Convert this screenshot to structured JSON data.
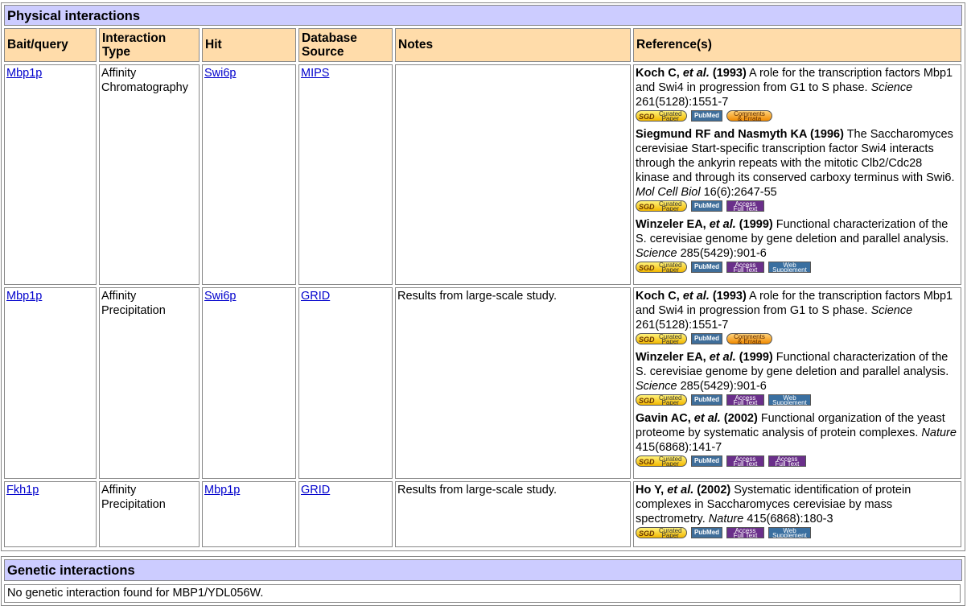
{
  "physical": {
    "title": "Physical interactions",
    "headers": {
      "bait": "Bait/query",
      "itype": "Interaction Type",
      "hit": "Hit",
      "db": "Database Source",
      "notes": "Notes",
      "refs": "Reference(s)"
    },
    "rows": [
      {
        "bait": "Mbp1p",
        "itype": "Affinity Chromatography",
        "hit": "Swi6p",
        "db": "MIPS",
        "notes": "",
        "refs": [
          {
            "authors": "Koch C, ",
            "etal": "et al.",
            "year": " (1993)",
            "text": " A role for the transcription factors Mbp1 and Swi4 in progression from G1 to S phase. ",
            "journal": "Science",
            "cite": " 261(5128):1551-7",
            "badges": [
              "sgd",
              "pubmed",
              "comments"
            ]
          },
          {
            "authors": "Siegmund RF and Nasmyth KA",
            "etal": "",
            "year": " (1996)",
            "text": " The Saccharomyces cerevisiae Start-specific transcription factor Swi4 interacts through the ankyrin repeats with the mitotic Clb2/Cdc28 kinase and through its conserved carboxy terminus with Swi6. ",
            "journal": "Mol Cell Biol",
            "cite": " 16(6):2647-55",
            "badges": [
              "sgd",
              "pubmed",
              "access"
            ]
          },
          {
            "authors": "Winzeler EA, ",
            "etal": "et al.",
            "year": " (1999)",
            "text": " Functional characterization of the S. cerevisiae genome by gene deletion and parallel analysis. ",
            "journal": "Science",
            "cite": " 285(5429):901-6",
            "badges": [
              "sgd",
              "pubmed",
              "access",
              "web"
            ]
          }
        ]
      },
      {
        "bait": "Mbp1p",
        "itype": "Affinity Precipitation",
        "hit": "Swi6p",
        "db": "GRID",
        "notes": "Results from large-scale study.",
        "refs": [
          {
            "authors": "Koch C, ",
            "etal": "et al.",
            "year": " (1993)",
            "text": " A role for the transcription factors Mbp1 and Swi4 in progression from G1 to S phase. ",
            "journal": "Science",
            "cite": " 261(5128):1551-7",
            "badges": [
              "sgd",
              "pubmed",
              "comments"
            ]
          },
          {
            "authors": "Winzeler EA, ",
            "etal": "et al.",
            "year": " (1999)",
            "text": " Functional characterization of the S. cerevisiae genome by gene deletion and parallel analysis. ",
            "journal": "Science",
            "cite": " 285(5429):901-6",
            "badges": [
              "sgd",
              "pubmed",
              "access",
              "web"
            ]
          },
          {
            "authors": "Gavin AC, ",
            "etal": "et al.",
            "year": " (2002)",
            "text": " Functional organization of the yeast proteome by systematic analysis of protein complexes. ",
            "journal": "Nature",
            "cite": " 415(6868):141-7",
            "badges": [
              "sgd",
              "pubmed",
              "access",
              "access"
            ]
          }
        ]
      },
      {
        "bait": "Fkh1p",
        "itype": "Affinity Precipitation",
        "hit": "Mbp1p",
        "db": "GRID",
        "notes": "Results from large-scale study.",
        "refs": [
          {
            "authors": "Ho Y, ",
            "etal": "et al.",
            "year": " (2002)",
            "text": " Systematic identification of protein complexes in Saccharomyces cerevisiae by mass spectrometry. ",
            "journal": "Nature",
            "cite": " 415(6868):180-3",
            "badges": [
              "sgd",
              "pubmed",
              "access",
              "web"
            ]
          }
        ]
      }
    ]
  },
  "badges": {
    "sgd": {
      "logo": "SGD",
      "l1": "Curated",
      "l2": "Paper"
    },
    "pubmed": {
      "l1": "PubMed"
    },
    "comments": {
      "l1": "Comments",
      "l2": "& Errata"
    },
    "access": {
      "l1": "Access",
      "l2": "Full Text"
    },
    "web": {
      "l1": "Web",
      "l2": "Supplement"
    }
  },
  "genetic": {
    "title": "Genetic interactions",
    "message": "No genetic interaction found for MBP1/YDL056W."
  },
  "colors": {
    "section_bg": "#ccccff",
    "header_bg": "#ffdcaa",
    "link": "#0000cc"
  }
}
